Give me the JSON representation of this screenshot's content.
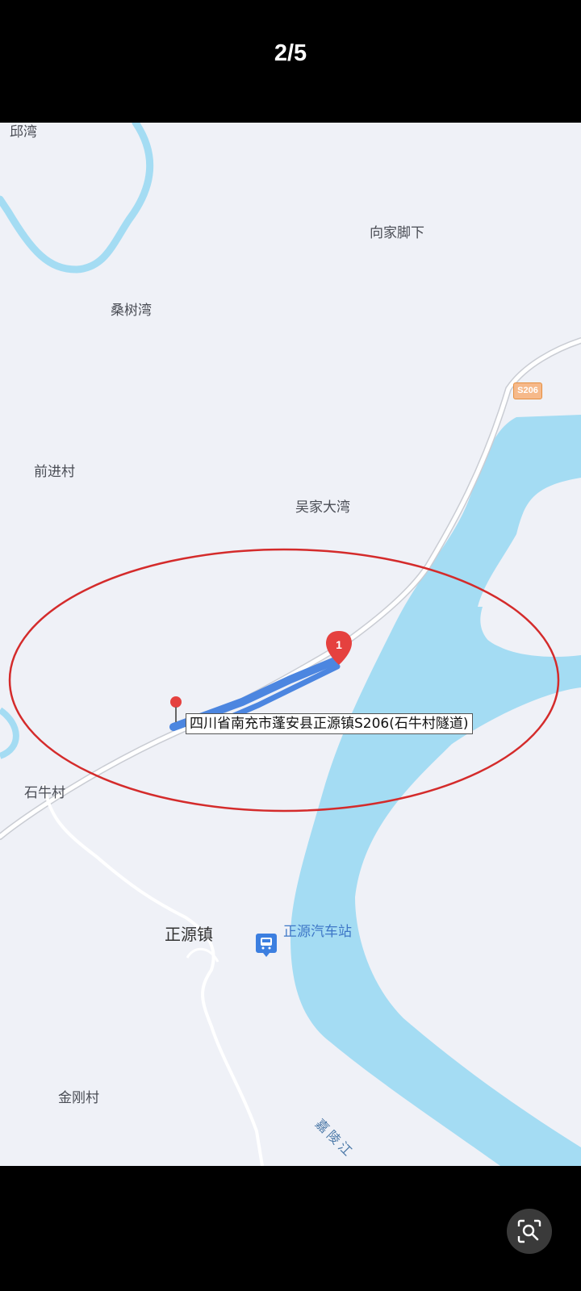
{
  "viewer": {
    "counter": "2/5",
    "lens_icon": "image-search-icon"
  },
  "map": {
    "places": {
      "qiuwan": "邱湾",
      "xiangjiajiaoxia": "向家脚下",
      "sangshuwan": "桑树湾",
      "qianjincun": "前进村",
      "wujiadawan": "吴家大湾",
      "shiniucun": "石牛村",
      "zhengyuanzhen": "正源镇",
      "jingangcun": "金刚村"
    },
    "road_shield": "S206",
    "bus_station": "正源汽车站",
    "river_name": "嘉陵江",
    "marker_number": "1",
    "address_label": "四川省南充市蓬安县正源镇S206(石牛村隧道)",
    "colors": {
      "river": "#a4dcf3",
      "highlight_ellipse": "#d42b2b",
      "route": "#4c86e0",
      "marker": "#e5413f"
    }
  }
}
